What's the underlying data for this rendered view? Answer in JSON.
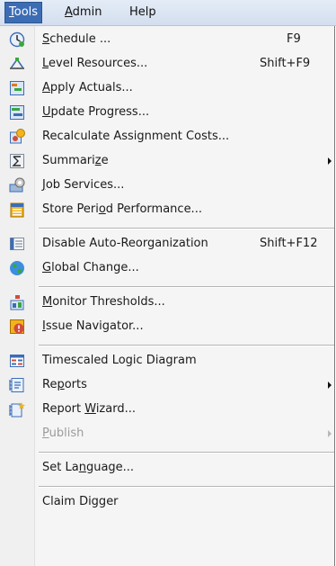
{
  "menubar": {
    "tools": {
      "pre": "",
      "m": "T",
      "post": "ools"
    },
    "admin": {
      "pre": "",
      "m": "A",
      "post": "dmin"
    },
    "help": {
      "pre": "Help",
      "m": "",
      "post": ""
    }
  },
  "menu": {
    "schedule": {
      "pre": "",
      "m": "S",
      "post": "chedule ...",
      "shortcut": "F9",
      "icon": "schedule-icon"
    },
    "level_resources": {
      "pre": "",
      "m": "L",
      "post": "evel Resources...",
      "shortcut": "Shift+F9",
      "icon": "level-resources-icon"
    },
    "apply_actuals": {
      "pre": "",
      "m": "A",
      "post": "pply Actuals...",
      "icon": "apply-actuals-icon"
    },
    "update_progress": {
      "pre": "",
      "m": "U",
      "post": "pdate Progress...",
      "icon": "update-progress-icon"
    },
    "recalculate": {
      "pre": "Recalculate Assignment Costs...",
      "m": "",
      "post": "",
      "icon": "recalculate-icon"
    },
    "summarize": {
      "pre": "Summari",
      "m": "z",
      "post": "e",
      "icon": "summarize-icon"
    },
    "job_services": {
      "pre": "",
      "m": "J",
      "post": "ob Services...",
      "icon": "job-services-icon"
    },
    "store_period": {
      "pre": "Store Peri",
      "m": "o",
      "post": "d Performance...",
      "icon": "store-period-icon"
    },
    "disable_reorg": {
      "pre": "Disable Auto-Reorganization",
      "m": "",
      "post": "",
      "shortcut": "Shift+F12",
      "icon": "reorganization-icon"
    },
    "global_change": {
      "pre": "",
      "m": "G",
      "post": "lobal Change...",
      "icon": "globe-icon"
    },
    "monitor_thresholds": {
      "pre": "",
      "m": "M",
      "post": "onitor Thresholds...",
      "icon": "thresholds-icon"
    },
    "issue_navigator": {
      "pre": "",
      "m": "I",
      "post": "ssue Navigator...",
      "icon": "issue-navigator-icon"
    },
    "timescaled": {
      "pre": "Timescaled Logic Diagram",
      "m": "",
      "post": "",
      "icon": "timescaled-diagram-icon"
    },
    "reports": {
      "pre": "Re",
      "m": "p",
      "post": "orts",
      "icon": "reports-icon"
    },
    "report_wizard": {
      "pre": "Report ",
      "m": "W",
      "post": "izard...",
      "icon": "report-wizard-icon"
    },
    "publish": {
      "pre": "",
      "m": "P",
      "post": "ublish"
    },
    "set_language": {
      "pre": "Set La",
      "m": "n",
      "post": "guage..."
    },
    "claim_digger": {
      "pre": "Claim Digger",
      "m": "",
      "post": ""
    }
  },
  "colors": {
    "highlight": "#3c6db4",
    "disabled_text": "#9c9c9c"
  }
}
